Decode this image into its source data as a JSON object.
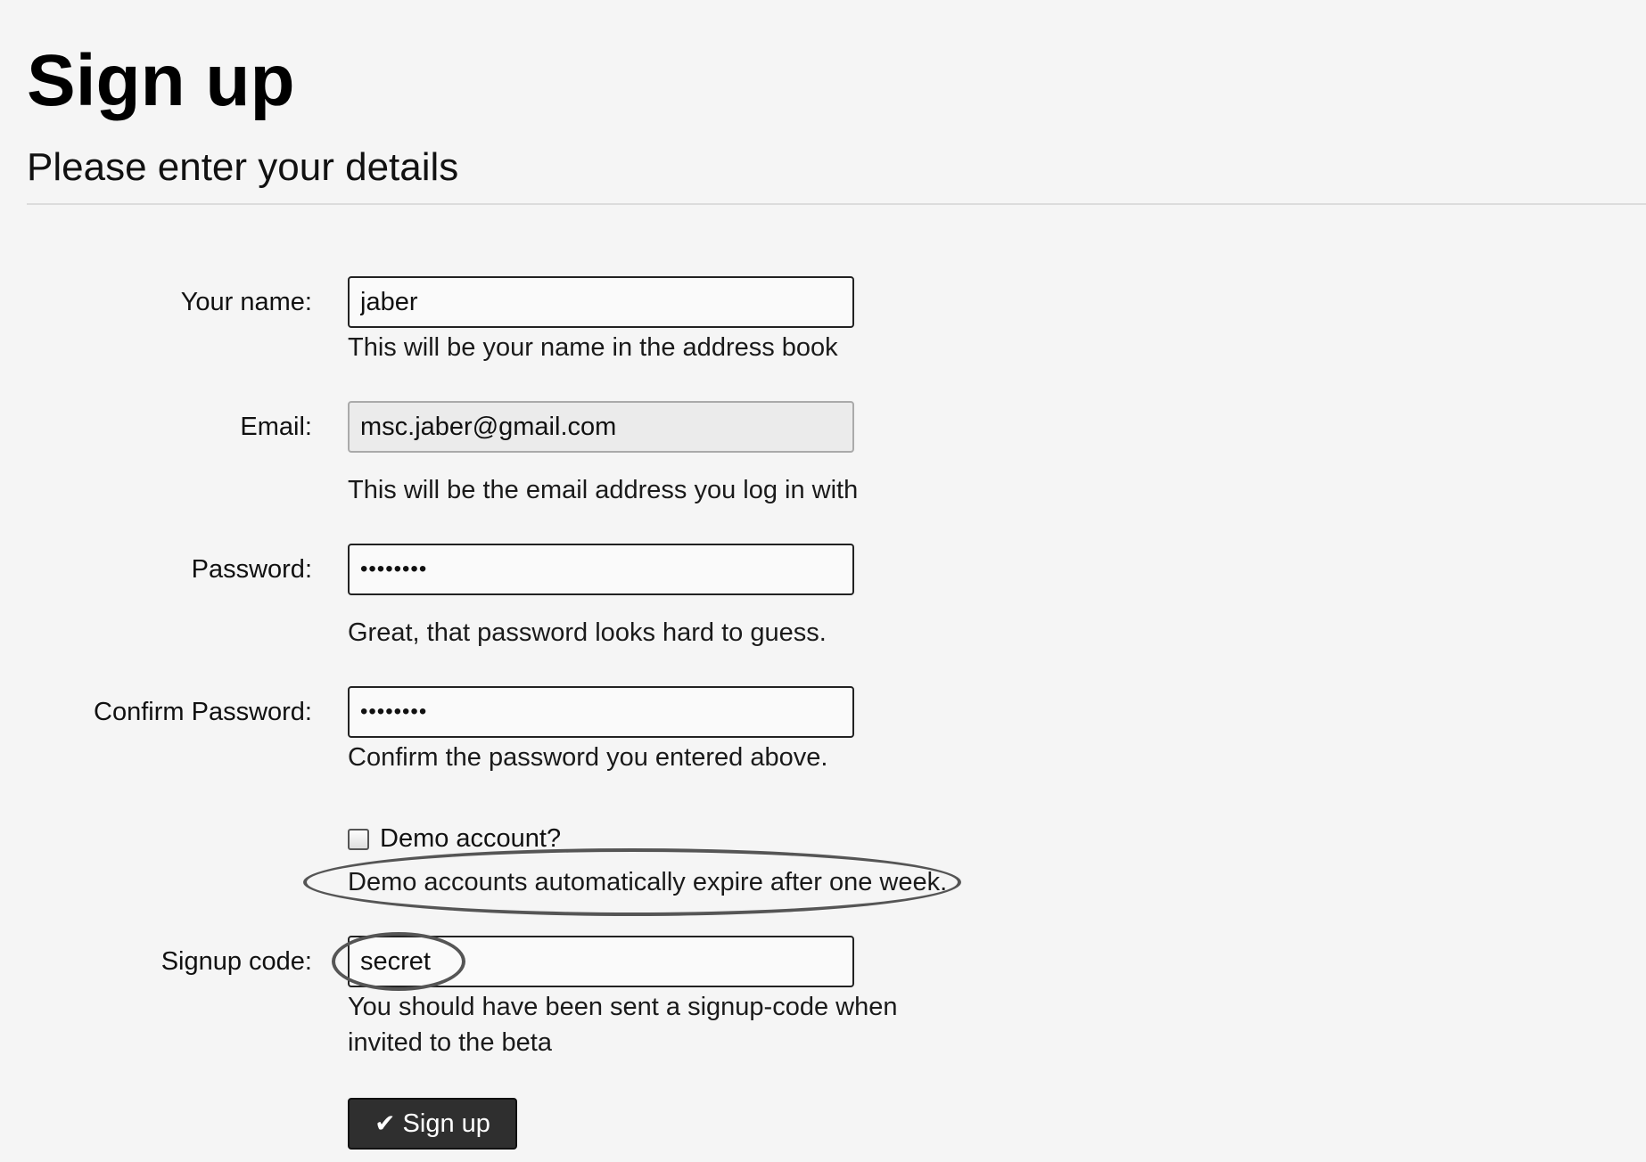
{
  "page": {
    "title": "Sign up",
    "subtitle": "Please enter your details"
  },
  "form": {
    "name": {
      "label": "Your name:",
      "value": "jaber",
      "help": "This will be your name in the address book"
    },
    "email": {
      "label": "Email:",
      "value": "msc.jaber@gmail.com",
      "help": "This will be the email address you log in with"
    },
    "password": {
      "label": "Password:",
      "value": "••••••••",
      "help": "Great, that password looks hard to guess."
    },
    "confirm_password": {
      "label": "Confirm Password:",
      "value": "••••••••",
      "help": "Confirm the password you entered above."
    },
    "demo": {
      "label": "Demo account?",
      "checked": false,
      "help": "Demo accounts automatically expire after one week."
    },
    "signup_code": {
      "label": "Signup code:",
      "value": "secret",
      "help": "You should have been sent a signup-code when invited to the beta"
    },
    "submit": {
      "label": "Sign up",
      "icon": "checkmark-icon"
    }
  }
}
